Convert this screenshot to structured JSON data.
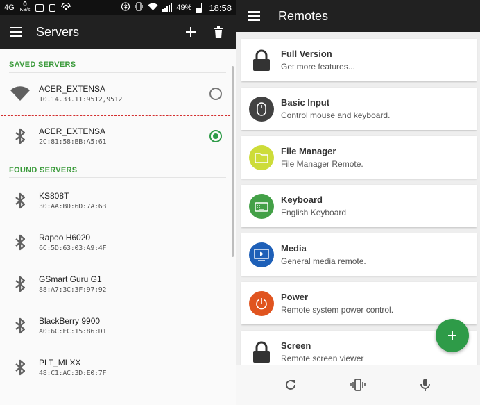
{
  "left": {
    "statusbar": {
      "carrier": "4G",
      "speed_value": "0",
      "speed_unit": "KB/s",
      "battery": "49%",
      "time": "18:58"
    },
    "appbar": {
      "title": "Servers"
    },
    "saved_label": "SAVED SERVERS",
    "found_label": "FOUND SERVERS",
    "saved": [
      {
        "icon": "wifi-icon",
        "name": "ACER_EXTENSA",
        "address": "10.14.33.11:9512,9512",
        "selected": false
      },
      {
        "icon": "bluetooth-icon",
        "name": "ACER_EXTENSA",
        "address": "2C:81:58:BB:A5:61",
        "selected": true
      }
    ],
    "found": [
      {
        "icon": "bluetooth-icon",
        "name": "KS808T",
        "address": "30:AA:BD:6D:7A:63"
      },
      {
        "icon": "bluetooth-icon",
        "name": "Rapoo H6020",
        "address": "6C:5D:63:03:A9:4F"
      },
      {
        "icon": "bluetooth-icon",
        "name": "GSmart Guru G1",
        "address": "88:A7:3C:3F:97:92"
      },
      {
        "icon": "bluetooth-icon",
        "name": "BlackBerry 9900",
        "address": "A0:6C:EC:15:86:D1"
      },
      {
        "icon": "bluetooth-icon",
        "name": "PLT_MLXX",
        "address": "48:C1:AC:3D:E0:7F"
      }
    ]
  },
  "right": {
    "appbar": {
      "title": "Remotes"
    },
    "remotes": [
      {
        "icon": "lock-icon",
        "color": "",
        "name": "Full Version",
        "desc": "Get more features..."
      },
      {
        "icon": "mouse-icon",
        "color": "#424242",
        "name": "Basic Input",
        "desc": "Control mouse and keyboard."
      },
      {
        "icon": "folder-icon",
        "color": "#cddc39",
        "name": "File Manager",
        "desc": "File Manager Remote."
      },
      {
        "icon": "keyboard-icon",
        "color": "#43a047",
        "name": "Keyboard",
        "desc": "English Keyboard"
      },
      {
        "icon": "media-icon",
        "color": "#1e60b8",
        "name": "Media",
        "desc": "General media remote."
      },
      {
        "icon": "power-icon",
        "color": "#e0541f",
        "name": "Power",
        "desc": "Remote system power control."
      },
      {
        "icon": "lock-icon",
        "color": "",
        "name": "Screen",
        "desc": "Remote screen viewer"
      }
    ],
    "bottom_icons": [
      "refresh-icon",
      "vibrate-icon",
      "mic-icon"
    ],
    "fab_icon": "plus-icon"
  },
  "colors": {
    "accent_green": "#2e9b48",
    "appbar": "#212121",
    "selection_outline": "#d32f2f"
  }
}
